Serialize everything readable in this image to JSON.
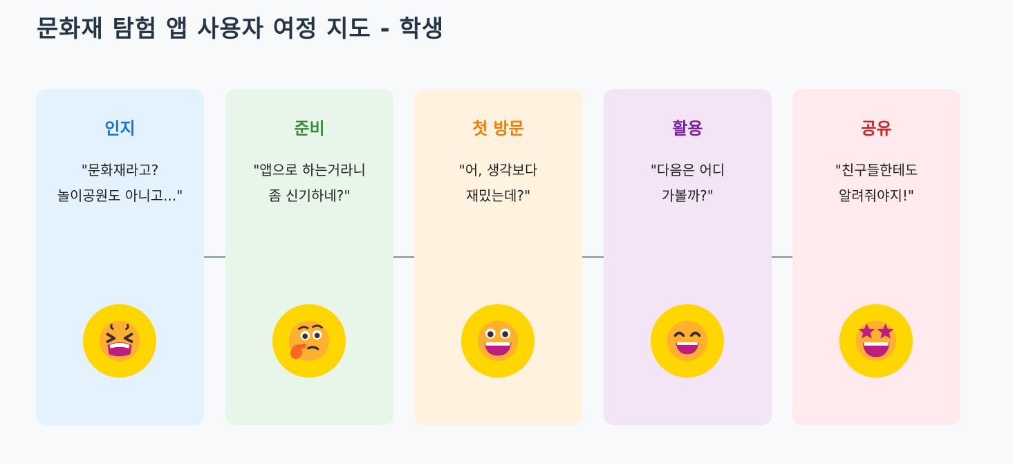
{
  "title": "문화재 탐험 앱 사용자 여정 지도 - 학생",
  "stages": [
    {
      "name": "인지",
      "quote": "\"문화재라고?\n놀이공원도 아니고...\"",
      "emotion_icon": "tired-face-icon",
      "bg_color": "#e3f2fd",
      "title_color": "#1976d2"
    },
    {
      "name": "준비",
      "quote": "\"앱으로 하는거라니\n좀 신기하네?\"",
      "emotion_icon": "thinking-face-icon",
      "bg_color": "#e8f5e9",
      "title_color": "#388e3c"
    },
    {
      "name": "첫 방문",
      "quote": "\"어, 생각보다\n재밌는데?\"",
      "emotion_icon": "grinning-face-big-eyes-icon",
      "bg_color": "#fff3e0",
      "title_color": "#f57c00"
    },
    {
      "name": "활용",
      "quote": "\"다음은 어디\n가볼까?\"",
      "emotion_icon": "smiling-face-smiling-eyes-icon",
      "bg_color": "#f3e5f5",
      "title_color": "#7b1fa2"
    },
    {
      "name": "공유",
      "quote": "\"친구들한테도\n알려줘야지!\"",
      "emotion_icon": "star-struck-icon",
      "bg_color": "#ffebee",
      "title_color": "#c62828"
    }
  ],
  "colors": {
    "connector": "#96a9b4",
    "emoji_circle": "#ffd600",
    "emoji_face": "#ffb02e"
  }
}
